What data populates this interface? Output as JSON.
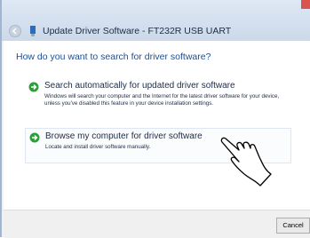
{
  "window": {
    "title": "Update Driver Software - FT232R USB UART",
    "question": "How do you want to search for driver software?"
  },
  "options": [
    {
      "title": "Search automatically for updated driver software",
      "description": "Windows will search your computer and the Internet for the latest driver software for your device, unless you've disabled this feature in your device installation settings."
    },
    {
      "title": "Browse my computer for driver software",
      "description": "Locate and install driver software manually."
    }
  ],
  "footer": {
    "cancel_label": "Cancel"
  },
  "colors": {
    "accent": "#1f4e93",
    "arrow": "#2e9e3a",
    "titlebar": "#cbd9ea"
  }
}
